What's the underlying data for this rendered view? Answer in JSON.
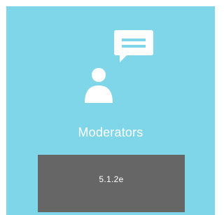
{
  "tile": {
    "label": "Moderators",
    "icon": "moderator-chat-person-icon",
    "background_color": "#7fd6e8",
    "version": "5.1.2e",
    "version_background_color": "#666666"
  }
}
